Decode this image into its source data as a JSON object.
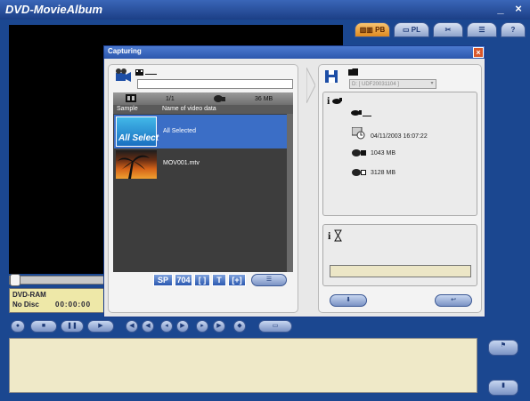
{
  "window": {
    "title": "DVD-MovieAlbum",
    "min_icon": "minimize-icon",
    "close_icon": "close-icon",
    "min_symbol": "_",
    "close_symbol": "×"
  },
  "tabs": [
    {
      "label": "PB",
      "icon": "film-icon"
    },
    {
      "label": "PL",
      "icon": "playlist-icon"
    },
    {
      "label": "",
      "icon": "edit-icon"
    },
    {
      "label": "",
      "icon": "settings-icon"
    },
    {
      "label": "?",
      "icon": "help-icon"
    }
  ],
  "status": {
    "drive": "DVD-RAM",
    "disc": "No Disc",
    "time": "00:00:00"
  },
  "dialog": {
    "title": "Capturing",
    "close_symbol": "×",
    "left": {
      "label_placeholder": "",
      "header": {
        "count": "1/1",
        "size": "36 MB"
      },
      "columns": {
        "sample": "Sample",
        "name": "Name of video data"
      },
      "rows": [
        {
          "thumb_text": "All Select",
          "name": "All Selected",
          "selected": true
        },
        {
          "thumb_text": "",
          "name": "MOV001.mtv",
          "selected": false
        }
      ],
      "toolbar": {
        "sp": "SP",
        "res": "704",
        "crop": "[  ]",
        "title": "T",
        "fit": "[+]",
        "settings_icon": "settings-icon"
      }
    },
    "right": {
      "drive_value": "D: [ UDF20031104 ]",
      "date": "04/11/2003 16:07:22",
      "used": "1043 MB",
      "free": "3128 MB",
      "progress": 0
    },
    "buttons": {
      "ok_icon": "down-arrow-icon",
      "back_icon": "back-arrow-icon"
    }
  },
  "colors": {
    "frame": "#1b4790",
    "accent": "#3b6ec6",
    "panel": "#efe9c8"
  }
}
